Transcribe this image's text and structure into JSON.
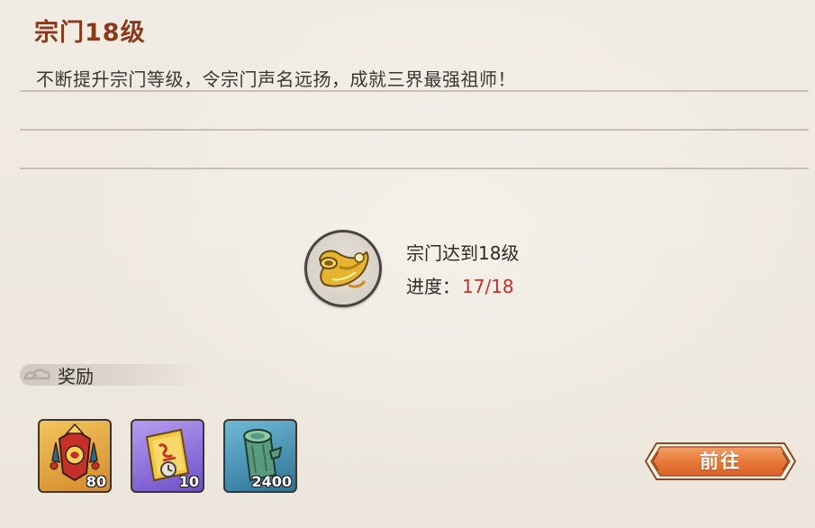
{
  "task": {
    "title": "宗门18级",
    "description": "不断提升宗门等级，令宗门声名远扬，成就三界最强祖师！",
    "icon": "golden-horn-icon",
    "condition": "宗门达到18级",
    "progress_label": "进度：",
    "progress_text": "17/18",
    "progress_current": 17,
    "progress_total": 18
  },
  "rewards": {
    "title": "奖励",
    "header_icon": "cloud-icon",
    "items": [
      {
        "icon": "sect-banner-icon",
        "count": "80"
      },
      {
        "icon": "golden-scroll-icon",
        "count": "10"
      },
      {
        "icon": "jade-wood-log-icon",
        "count": "2400"
      }
    ]
  },
  "actions": {
    "go_label": "前往"
  },
  "colors": {
    "title": "#8a3a1c",
    "progress_value": "#c6312a",
    "button": "#e8793a",
    "background": "#efe9df"
  }
}
